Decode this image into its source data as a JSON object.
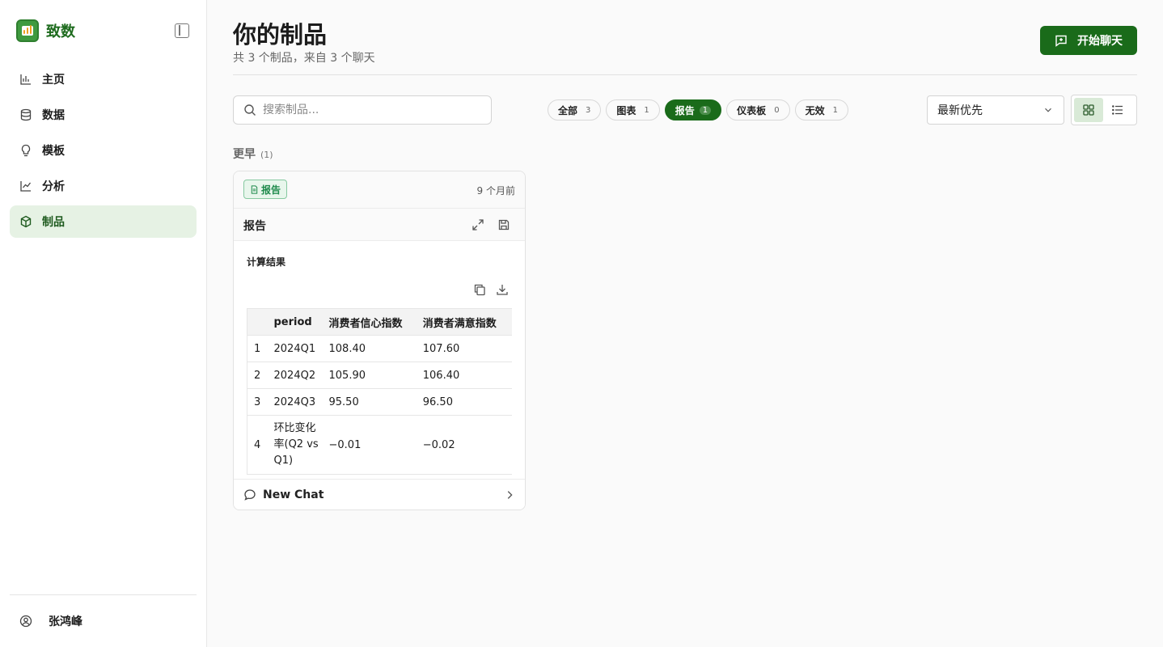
{
  "sidebar": {
    "brand": "致数",
    "items": [
      {
        "label": "主页",
        "icon": "bar-chart-icon"
      },
      {
        "label": "数据",
        "icon": "database-icon"
      },
      {
        "label": "模板",
        "icon": "lightbulb-icon"
      },
      {
        "label": "分析",
        "icon": "line-chart-icon"
      },
      {
        "label": "制品",
        "icon": "cube-icon",
        "active": true
      }
    ],
    "user": "张鸿峰"
  },
  "header": {
    "title": "你的制品",
    "subtitle": "共 3 个制品，来自 3 个聊天",
    "start_chat_label": "开始聊天"
  },
  "toolbar": {
    "search_placeholder": "搜索制品...",
    "filters": [
      {
        "label": "全部",
        "count": "3"
      },
      {
        "label": "图表",
        "count": "1"
      },
      {
        "label": "报告",
        "count": "1",
        "active": true
      },
      {
        "label": "仪表板",
        "count": "0"
      },
      {
        "label": "无效",
        "count": "1"
      }
    ],
    "sort_value": "最新优先"
  },
  "group": {
    "label": "更早",
    "count": "(1)"
  },
  "card": {
    "badge": "报告",
    "time": "9 个月前",
    "title": "报告",
    "report_title": "计算结果",
    "columns": [
      "",
      "period",
      "消费者信心指数",
      "消费者满意指数"
    ],
    "rows": [
      [
        "1",
        "2024Q1",
        "108.40",
        "107.60"
      ],
      [
        "2",
        "2024Q2",
        "105.90",
        "106.40"
      ],
      [
        "3",
        "2024Q3",
        "95.50",
        "96.50"
      ],
      [
        "4",
        "环比变化率(Q2 vs Q1)",
        "−0.01",
        "−0.02"
      ]
    ],
    "footer": "New Chat"
  },
  "colors": {
    "accent": "#1a6b1a",
    "active_nav_bg": "#e6f2e4",
    "badge_green": "#1f8a4c"
  }
}
